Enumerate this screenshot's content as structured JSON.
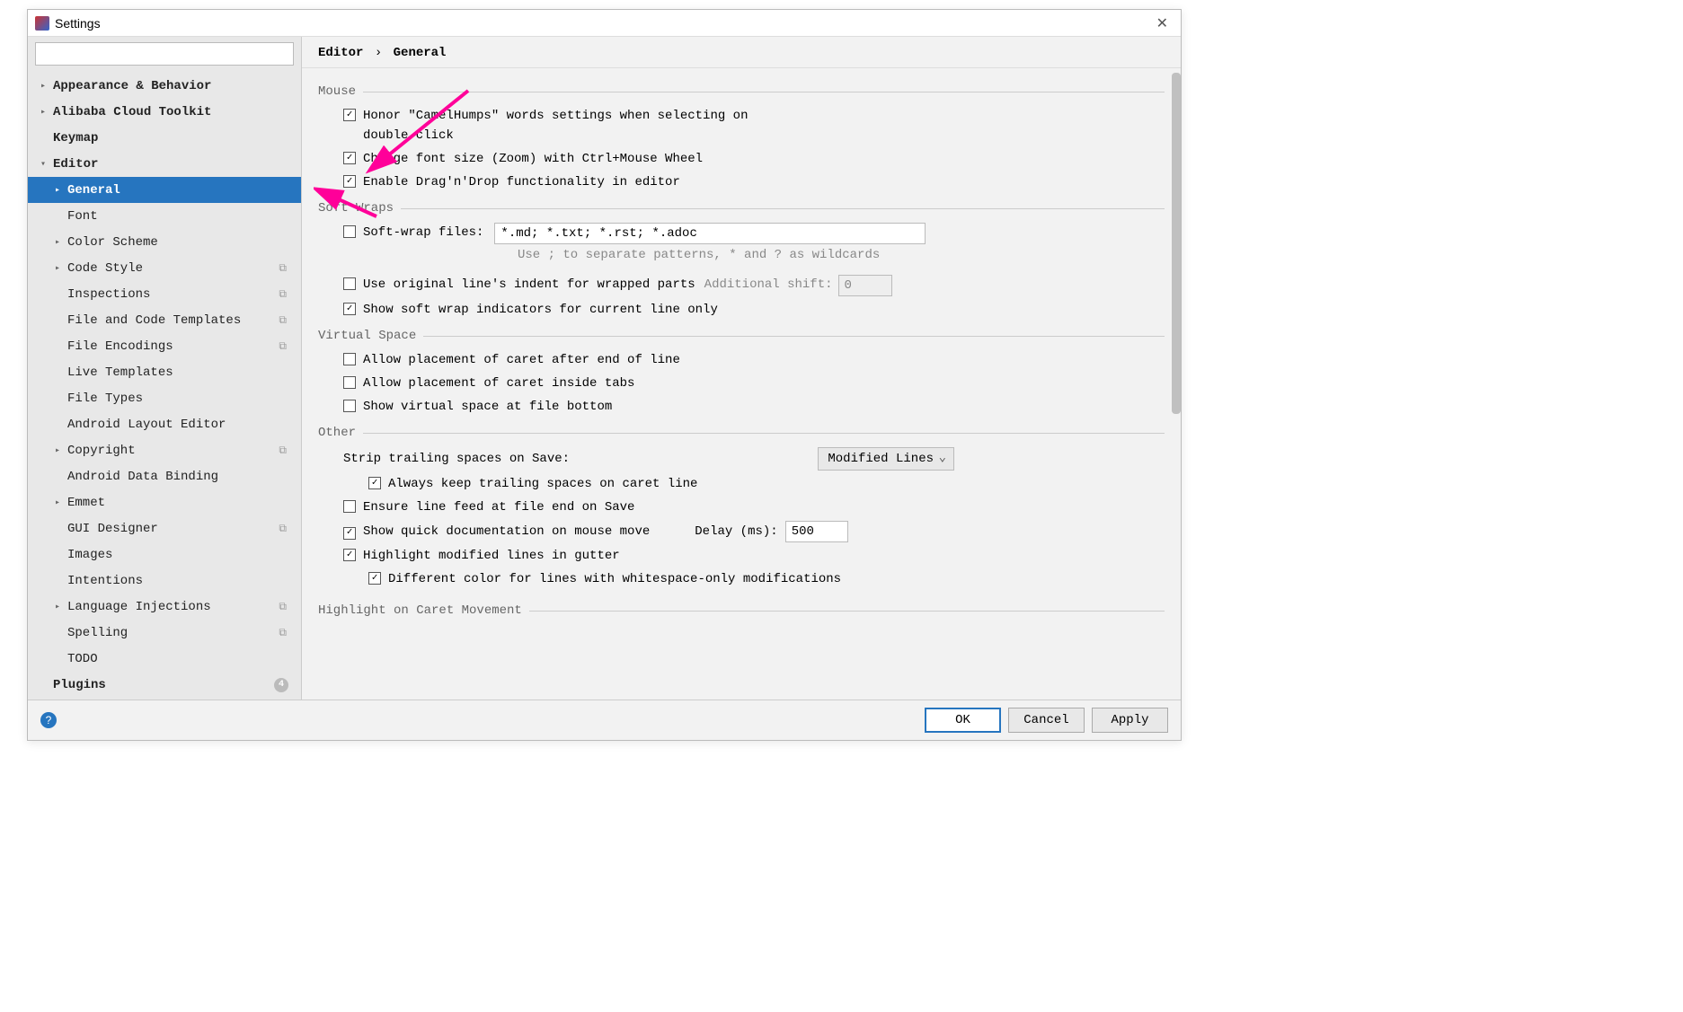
{
  "window": {
    "title": "Settings"
  },
  "search": {
    "placeholder": ""
  },
  "sidebar": {
    "items": [
      {
        "label": "Appearance & Behavior",
        "arrow": "right",
        "bold": true,
        "level": 0
      },
      {
        "label": "Alibaba Cloud Toolkit",
        "arrow": "right",
        "bold": true,
        "level": 0
      },
      {
        "label": "Keymap",
        "arrow": "none",
        "bold": true,
        "level": 0
      },
      {
        "label": "Editor",
        "arrow": "down",
        "bold": true,
        "level": 0
      },
      {
        "label": "General",
        "arrow": "right",
        "bold": true,
        "level": 1,
        "selected": true
      },
      {
        "label": "Font",
        "arrow": "none",
        "bold": false,
        "level": 1
      },
      {
        "label": "Color Scheme",
        "arrow": "right",
        "bold": false,
        "level": 1
      },
      {
        "label": "Code Style",
        "arrow": "right",
        "bold": false,
        "level": 1,
        "scheme": true
      },
      {
        "label": "Inspections",
        "arrow": "none",
        "bold": false,
        "level": 1,
        "scheme": true
      },
      {
        "label": "File and Code Templates",
        "arrow": "none",
        "bold": false,
        "level": 1,
        "scheme": true
      },
      {
        "label": "File Encodings",
        "arrow": "none",
        "bold": false,
        "level": 1,
        "scheme": true
      },
      {
        "label": "Live Templates",
        "arrow": "none",
        "bold": false,
        "level": 1
      },
      {
        "label": "File Types",
        "arrow": "none",
        "bold": false,
        "level": 1
      },
      {
        "label": "Android Layout Editor",
        "arrow": "none",
        "bold": false,
        "level": 1
      },
      {
        "label": "Copyright",
        "arrow": "right",
        "bold": false,
        "level": 1,
        "scheme": true
      },
      {
        "label": "Android Data Binding",
        "arrow": "none",
        "bold": false,
        "level": 1
      },
      {
        "label": "Emmet",
        "arrow": "right",
        "bold": false,
        "level": 1
      },
      {
        "label": "GUI Designer",
        "arrow": "none",
        "bold": false,
        "level": 1,
        "scheme": true
      },
      {
        "label": "Images",
        "arrow": "none",
        "bold": false,
        "level": 1
      },
      {
        "label": "Intentions",
        "arrow": "none",
        "bold": false,
        "level": 1
      },
      {
        "label": "Language Injections",
        "arrow": "right",
        "bold": false,
        "level": 1,
        "scheme": true
      },
      {
        "label": "Spelling",
        "arrow": "none",
        "bold": false,
        "level": 1,
        "scheme": true
      },
      {
        "label": "TODO",
        "arrow": "none",
        "bold": false,
        "level": 1
      },
      {
        "label": "Plugins",
        "arrow": "none",
        "bold": true,
        "level": 0,
        "badge": "4"
      }
    ]
  },
  "breadcrumb": {
    "a": "Editor",
    "sep": "›",
    "b": "General"
  },
  "sections": {
    "mouse": {
      "title": "Mouse",
      "camelhumps": "Honor \"CamelHumps\" words settings when selecting on double click",
      "zoom": "Change font size (Zoom) with Ctrl+Mouse Wheel",
      "dnd": "Enable Drag'n'Drop functionality in editor"
    },
    "softwraps": {
      "title": "Soft Wraps",
      "softwrap_label": "Soft-wrap files:",
      "softwrap_value": "*.md; *.txt; *.rst; *.adoc",
      "hint": "Use ; to separate patterns, * and ? as wildcards",
      "indent": "Use original line's indent for wrapped parts",
      "indent_extra_label": "Additional shift:",
      "indent_extra_value": "0",
      "indicators": "Show soft wrap indicators for current line only"
    },
    "virtual": {
      "title": "Virtual Space",
      "after_eol": "Allow placement of caret after end of line",
      "inside_tabs": "Allow placement of caret inside tabs",
      "bottom": "Show virtual space at file bottom"
    },
    "other": {
      "title": "Other",
      "strip_label": "Strip trailing spaces on Save:",
      "strip_value": "Modified Lines",
      "keep_caret": "Always keep trailing spaces on caret line",
      "ensure_lf": "Ensure line feed at file end on Save",
      "quickdoc": "Show quick documentation on mouse move",
      "delay_label": "Delay (ms):",
      "delay_value": "500",
      "highlight_mod": "Highlight modified lines in gutter",
      "diff_color": "Different color for lines with whitespace-only modifications"
    },
    "caret": {
      "title": "Highlight on Caret Movement"
    }
  },
  "footer": {
    "ok": "OK",
    "cancel": "Cancel",
    "apply": "Apply"
  }
}
